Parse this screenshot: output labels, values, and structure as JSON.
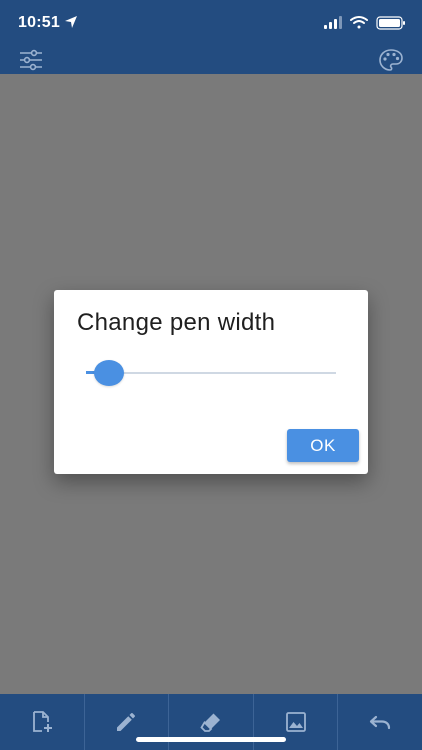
{
  "status_bar": {
    "time": "10:51",
    "icons": [
      "location-arrow-icon",
      "signal-icon",
      "wifi-icon",
      "battery-icon"
    ]
  },
  "app_bar": {
    "left_icon": "sliders-icon",
    "right_icon": "palette-icon",
    "color": "#234c80"
  },
  "dialog": {
    "title": "Change pen width",
    "slider_value_fraction": 0.09,
    "ok_label": "OK",
    "accent": "#4a90e2"
  },
  "toolbar": {
    "items": [
      {
        "icon": "new-page-icon"
      },
      {
        "icon": "pen-icon"
      },
      {
        "icon": "eraser-icon"
      },
      {
        "icon": "image-icon"
      },
      {
        "icon": "undo-icon"
      }
    ]
  }
}
